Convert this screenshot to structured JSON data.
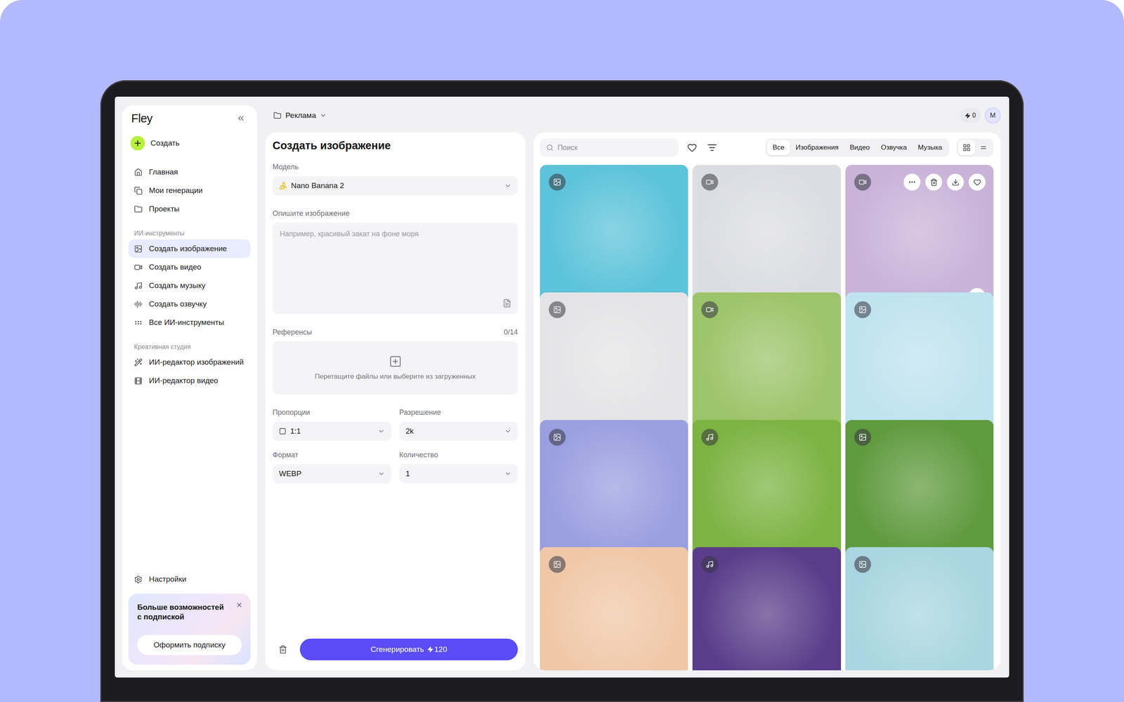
{
  "app": {
    "logo": "Fley",
    "project": "Реклама",
    "credits": "0",
    "avatar": "M"
  },
  "sidebar": {
    "create": "Создать",
    "groups": [
      {
        "items": [
          {
            "label": "Главная",
            "selected": false
          },
          {
            "label": "Мои генерации",
            "selected": false
          },
          {
            "label": "Проекты",
            "selected": false
          }
        ]
      },
      {
        "title": "ИИ-инструменты",
        "items": [
          {
            "label": "Создать изображение",
            "selected": true
          },
          {
            "label": "Создать видео",
            "selected": false
          },
          {
            "label": "Создать музыку",
            "selected": false
          },
          {
            "label": "Создать озвучку",
            "selected": false
          },
          {
            "label": "Все ИИ-инструменты",
            "selected": false
          }
        ]
      },
      {
        "title": "Креативная студия",
        "items": [
          {
            "label": "ИИ-редактор изображений",
            "selected": false
          },
          {
            "label": "ИИ-редактор видео",
            "selected": false
          }
        ]
      }
    ],
    "settings": "Настройки",
    "promo": {
      "title": "Больше возможностей с подпиской",
      "button": "Оформить подписку"
    }
  },
  "form": {
    "title": "Создать изображение",
    "model": {
      "label": "Модель",
      "value": "Nano Banana 2"
    },
    "prompt": {
      "label": "Опишите изображение",
      "placeholder": "Например, красивый закат на фоне моря"
    },
    "references": {
      "label": "Референсы",
      "count": "0/14",
      "hint": "Перетащите файлы или выберите из загруженных"
    },
    "fields": [
      {
        "label": "Пропорции",
        "value": "1:1",
        "kind": "aspect"
      },
      {
        "label": "Разрешение",
        "value": "2k",
        "kind": "plain"
      },
      {
        "label": "Формат",
        "value": "WEBP",
        "kind": "plain"
      },
      {
        "label": "Количество",
        "value": "1",
        "kind": "plain"
      }
    ],
    "generate": {
      "label": "Сгенерировать",
      "cost": "120"
    }
  },
  "gallery": {
    "search_placeholder": "Поиск",
    "filters": [
      {
        "label": "Все",
        "selected": true
      },
      {
        "label": "Изображения",
        "selected": false
      },
      {
        "label": "Видео",
        "selected": false
      },
      {
        "label": "Озвучка",
        "selected": false
      },
      {
        "label": "Музыка",
        "selected": false
      }
    ],
    "views": [
      {
        "kind": "grid",
        "selected": true
      },
      {
        "kind": "list",
        "selected": false
      }
    ],
    "items": [
      {
        "kind": "image",
        "color": "#5cc3da",
        "hovered": false
      },
      {
        "kind": "video",
        "color": "#dcdde2",
        "hovered": false
      },
      {
        "kind": "video",
        "color": "#c9b3d9",
        "hovered": true,
        "playing": true,
        "level": 0.15
      },
      {
        "kind": "image",
        "color": "#e4e4e6",
        "hovered": false
      },
      {
        "kind": "video",
        "color": "#9cc46a",
        "hovered": false
      },
      {
        "kind": "image",
        "color": "#bfe3ef",
        "hovered": false
      },
      {
        "kind": "image",
        "color": "#9a9fe0",
        "hovered": false
      },
      {
        "kind": "music",
        "color": "#7cb342",
        "hovered": false
      },
      {
        "kind": "image",
        "color": "#5f9a3e",
        "hovered": false
      },
      {
        "kind": "image",
        "color": "#f0c8a8",
        "hovered": false
      },
      {
        "kind": "music",
        "color": "#5a3d8a",
        "hovered": false
      },
      {
        "kind": "image",
        "color": "#a9d6e0",
        "hovered": false
      }
    ]
  }
}
